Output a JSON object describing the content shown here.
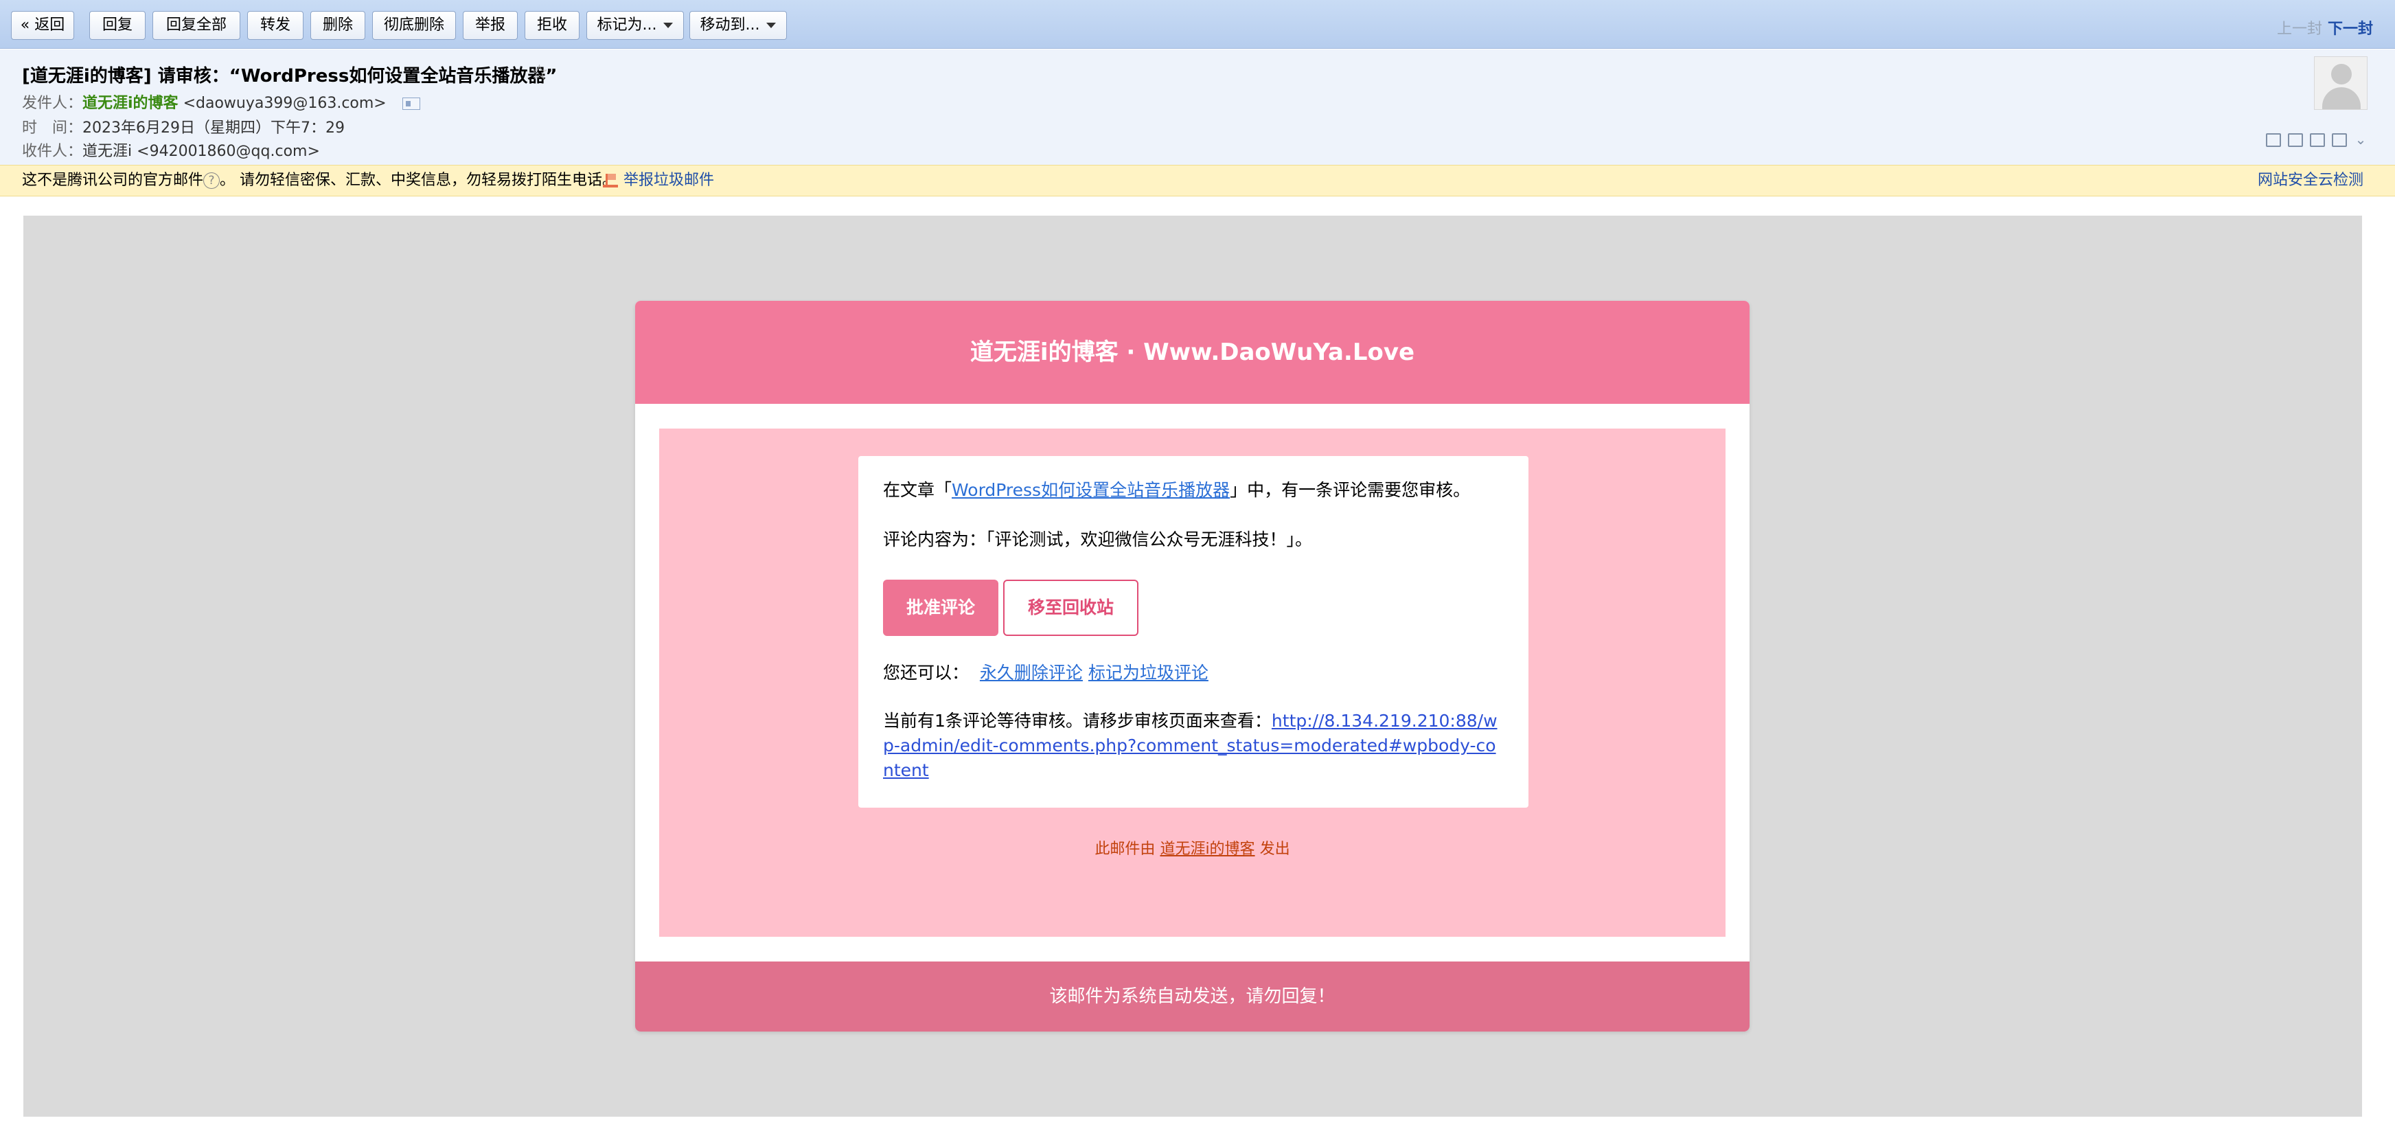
{
  "toolbar": {
    "back": "« 返回",
    "reply": "回复",
    "reply_all": "回复全部",
    "forward": "转发",
    "delete": "删除",
    "delete_forever": "彻底删除",
    "report": "举报",
    "reject": "拒收",
    "mark_as": "标记为...",
    "move_to": "移动到...",
    "prev": "上一封",
    "next": "下一封"
  },
  "header": {
    "subject": "[道无涯i的博客] 请审核：“WordPress如何设置全站音乐播放器”",
    "from_label": "发件人：",
    "from_name": "道无涯i的博客",
    "from_email": "<daowuya399@163.com>",
    "time_label": "时　间：",
    "time_value": "2023年6月29日（星期四）下午7：29",
    "to_label": "收件人：",
    "to_name": "道无涯i",
    "to_email": "<942001860@qq.com>"
  },
  "warning": {
    "text_1": "这不是腾讯公司的官方邮件",
    "help": "?",
    "text_2": "。 请勿轻信密保、汇款、中奖信息，勿轻易拨打陌生电话。",
    "report_spam": "举报垃圾邮件",
    "safety_check": "网站安全云检测"
  },
  "mail": {
    "site_title": "道无涯i的博客 · Www.DaoWuYa.Love",
    "line1_prefix": "在文章「",
    "article_link": "WordPress如何设置全站音乐播放器",
    "line1_suffix": "」中，有一条评论需要您审核。",
    "comment_line": "评论内容为：「评论测试，欢迎微信公众号无涯科技！」。",
    "approve": "批准评论",
    "trash": "移至回收站",
    "also_prefix": "您还可以：",
    "delete_link": "永久删除评论",
    "spam_link": "标记为垃圾评论",
    "pending_prefix": "当前有1条评论等待审核。请移步审核页面来查看：",
    "pending_url": "http://8.134.219.210:88/wp-admin/edit-comments.php?comment_status=moderated#wpbody-content",
    "sent_prefix": "此邮件由",
    "sent_site": "道无涯i的博客",
    "sent_suffix": "发出",
    "footer": "该邮件为系统自动发送，请勿回复！"
  },
  "colors": {
    "header_pink": "#f27a9b",
    "content_pink": "#ffc0cc",
    "footer_pink": "#e0718d",
    "approve_bg": "#ee7393",
    "trash_border": "#e14d76",
    "link_blue": "#2b6fd6"
  }
}
